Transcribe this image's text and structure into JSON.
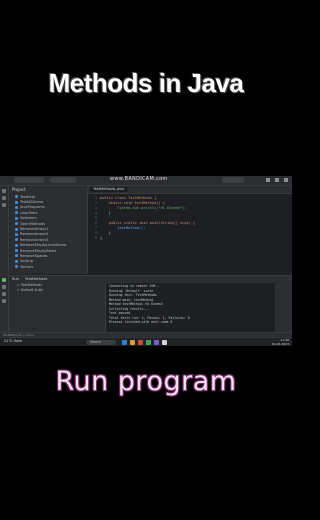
{
  "captions": {
    "top": "Methods in Java",
    "bottom": "Run  program"
  },
  "recorder_watermark": "www.BANDICAM.com",
  "ide": {
    "editor_tab": "TestMethods.java",
    "project_header": "Project",
    "run_tab_label": "Run",
    "run_config_label": "TestMethods",
    "project_tree": [
      "TestIntel",
      "TestNGDemo",
      "JavaPrograms",
      "LoopTests",
      "Selenium",
      "OpenMethods",
      "RemoveArrays1",
      "RemoveArrays2",
      "RemoveArrays3",
      "RemoveEmptyLinesDemo",
      "RemoveEmptyItems",
      "RemoveSpaces",
      "Sorting",
      "Vectors"
    ],
    "code_lines": [
      {
        "n": "1",
        "html_kind": "class",
        "text": "public class TestMethods {"
      },
      {
        "n": "2",
        "html_kind": "method",
        "text": "    static void testMethod() {"
      },
      {
        "n": "3",
        "html_kind": "print",
        "text": "        System.out.println(\"Hi Dinesh\");"
      },
      {
        "n": "4",
        "html_kind": "plain",
        "text": "    }"
      },
      {
        "n": "5",
        "html_kind": "plain",
        "text": ""
      },
      {
        "n": "6",
        "html_kind": "main",
        "text": "    public static void main(String[] args) {"
      },
      {
        "n": "7",
        "html_kind": "call",
        "text": "        testMethod();"
      },
      {
        "n": "8",
        "html_kind": "plain",
        "text": "    }"
      },
      {
        "n": "9",
        "html_kind": "plain",
        "text": "}"
      }
    ],
    "run_tree": [
      "TestMethods",
      "Default Suite"
    ],
    "console_lines": [
      "Connecting to remote JVM...",
      "Running 'Default' suite",
      "Running test: TestMethods",
      "Method main: testMethod",
      "Method testMethod: Hi Dinesh",
      "Collecting results...",
      "Test passed",
      "Total tests run: 1, Passes: 1, Failures: 0",
      "Process finished with exit code 0"
    ],
    "status_text": "TestMethods > main"
  },
  "taskbar": {
    "weather": "21°C Haze",
    "search_placeholder": "Search",
    "time": "11:46",
    "date": "10-03-2023",
    "app_colors": [
      "#2f7fd6",
      "#e0a030",
      "#d04a3a",
      "#35a853",
      "#7b5bd6",
      "#d6d6d6"
    ]
  }
}
